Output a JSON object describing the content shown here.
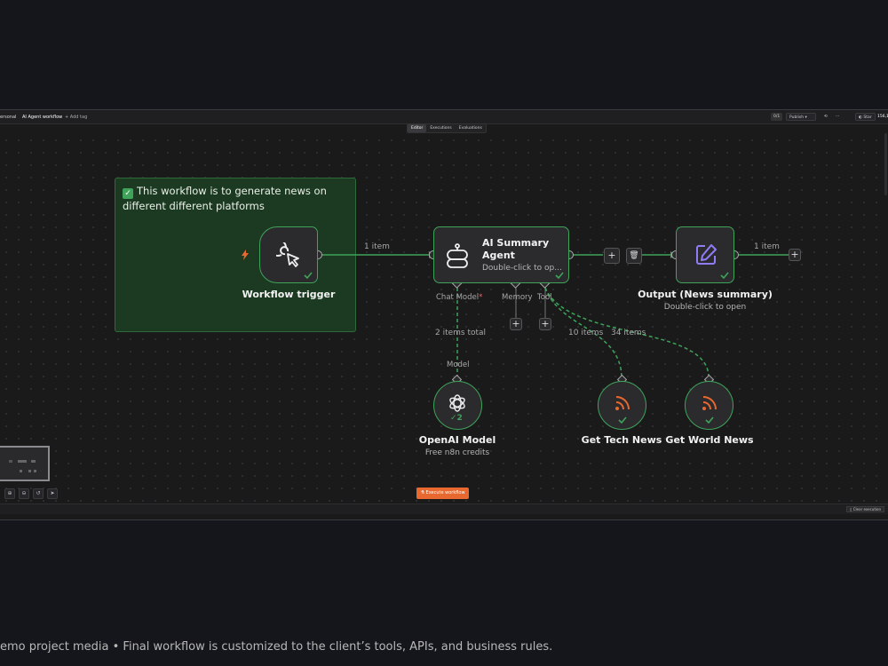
{
  "topbar": {
    "workspace": "ersonal",
    "workflow_name": "AI Agent workflow",
    "add_tag": "+ Add tag",
    "version": "0/1",
    "publish": "Publish",
    "more": "···",
    "star_label": "Star",
    "star_count": "156,150"
  },
  "tabs": [
    {
      "label": "Editor",
      "active": true
    },
    {
      "label": "Executions",
      "active": false
    },
    {
      "label": "Evaluations",
      "active": false
    }
  ],
  "sticky_note": {
    "text": "This workflow is to generate news on different different platforms",
    "color": "#1c3a22"
  },
  "nodes": {
    "trigger": {
      "title": "Workflow trigger",
      "icon": "cursor-click-icon"
    },
    "agent": {
      "title": "AI Summary Agent",
      "subtitle": "Double-click to op...",
      "icon": "robot-icon",
      "ports": {
        "chat_model": "Chat Model",
        "required_mark": "*",
        "memory": "Memory",
        "tool": "Tool"
      }
    },
    "output": {
      "title": "Output (News summary)",
      "subtitle": "Double-click to open",
      "icon": "edit-icon"
    },
    "openai": {
      "title": "OpenAI Model",
      "subtitle": "Free n8n credits",
      "icon": "openai-icon",
      "run_count": "2",
      "port_label": "Model"
    },
    "tech_news": {
      "title": "Get Tech News",
      "icon": "rss-icon"
    },
    "world_news": {
      "title": "Get World News",
      "icon": "rss-icon"
    }
  },
  "edges": {
    "trigger_to_agent": "1 item",
    "output_out": "1 item",
    "model_items": "2 items total",
    "tech_items": "10 items",
    "world_items": "34 items"
  },
  "buttons": {
    "execute_workflow": "Execute workflow",
    "clear_execution": "Clear execution"
  },
  "caption": "emo project media • Final workflow is customized to the client’s tools, APIs, and business rules.",
  "colors": {
    "success": "#3fa35a",
    "accent": "#e8692f",
    "background": "#15161b",
    "canvas": "#1a1a1b",
    "rss": "#e8692f",
    "edit_icon": "#8f7cf7"
  }
}
